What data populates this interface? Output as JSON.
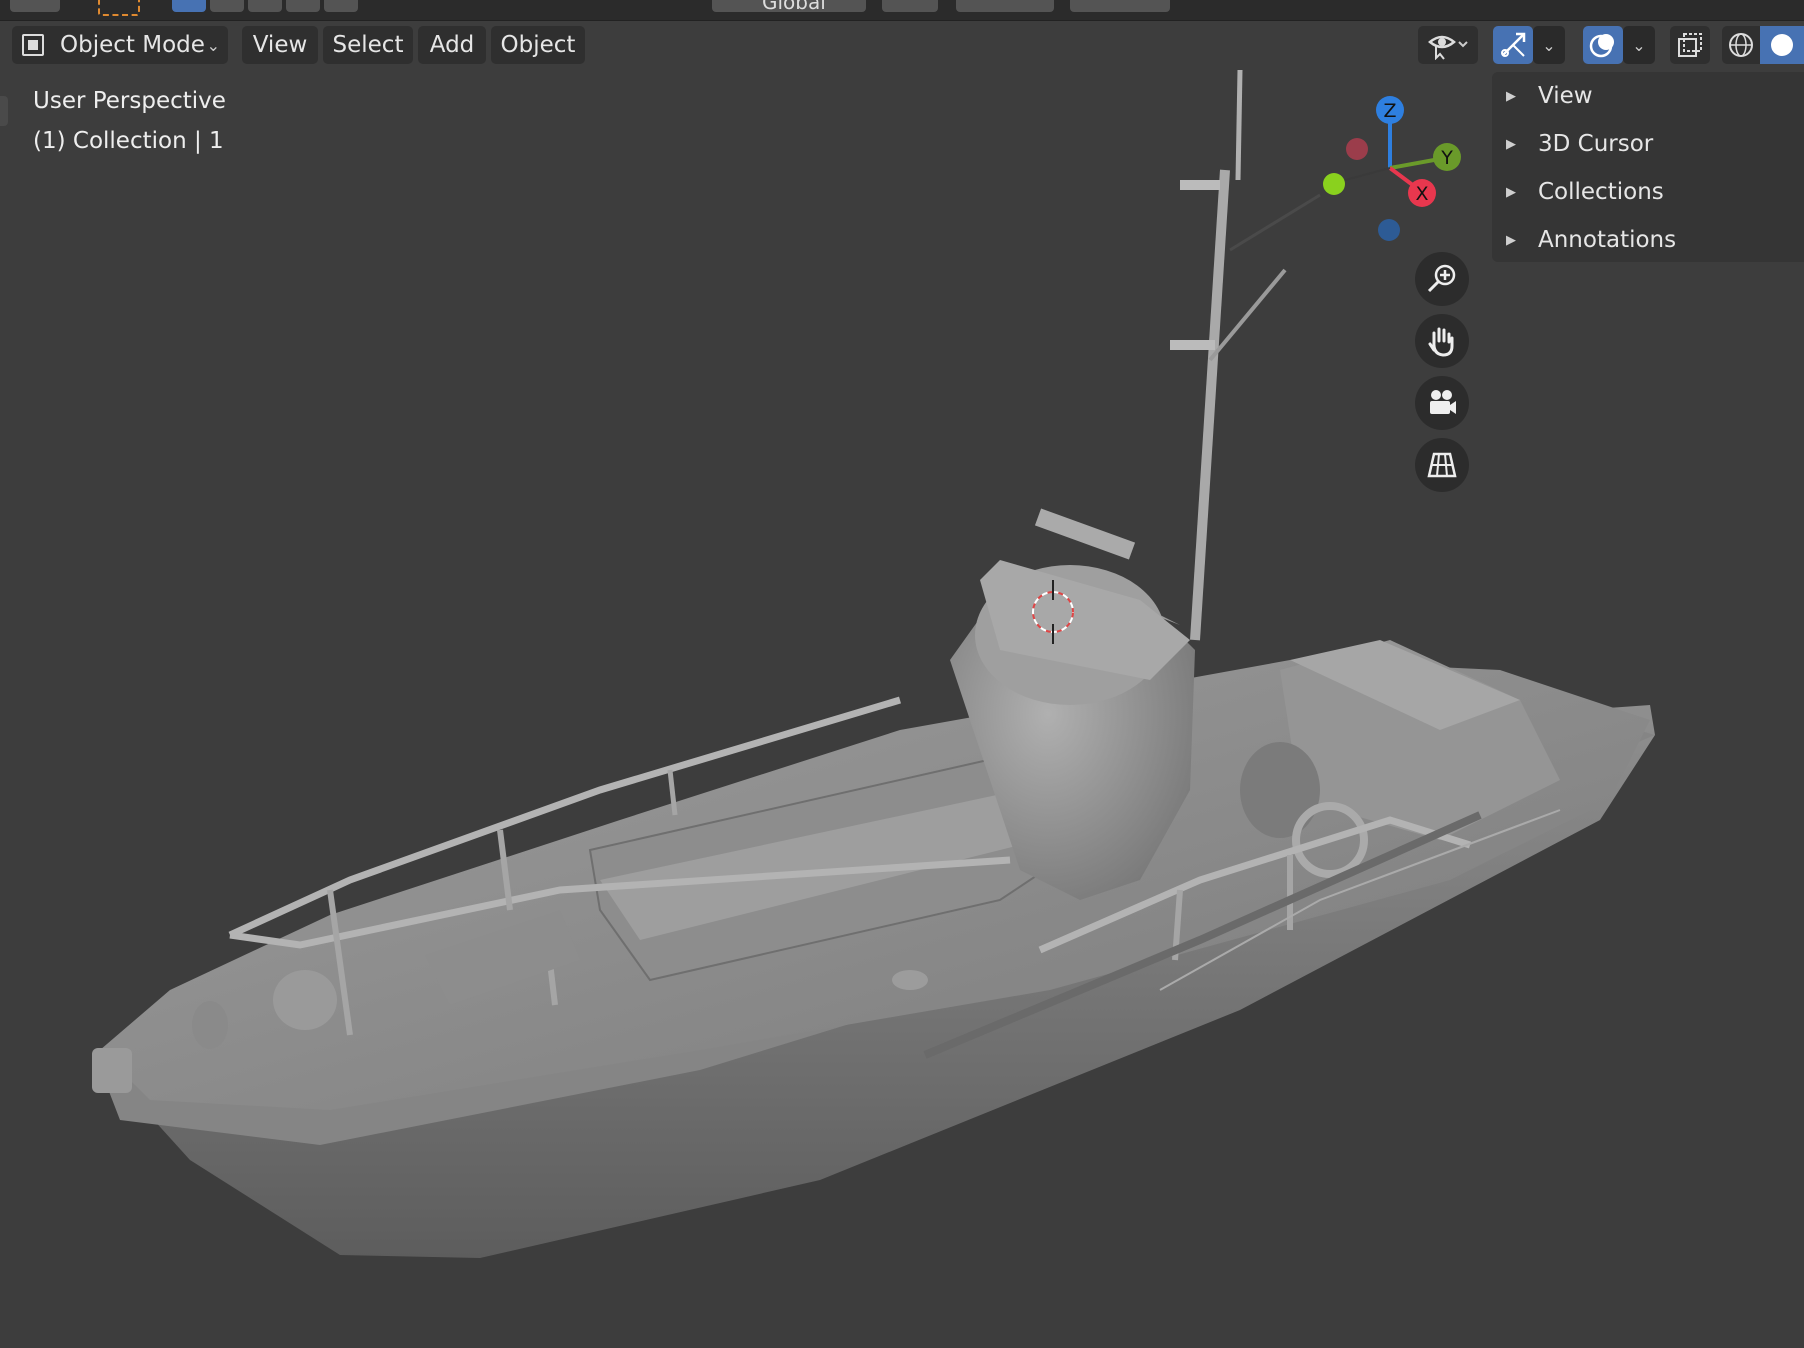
{
  "header": {
    "mode_label": "Object Mode",
    "menus": [
      "View",
      "Select",
      "Add",
      "Object"
    ]
  },
  "topbar": {
    "orientation_label": "Global"
  },
  "viewport": {
    "perspective_label": "User Perspective",
    "collection_label": "(1) Collection | 1"
  },
  "sidebar": {
    "items": [
      {
        "label": "View"
      },
      {
        "label": "3D Cursor"
      },
      {
        "label": "Collections"
      },
      {
        "label": "Annotations"
      }
    ]
  },
  "gizmo": {
    "axes": [
      {
        "label": "Z",
        "color": "#2e7fe0"
      },
      {
        "label": "Y",
        "color": "#6a9a2a"
      },
      {
        "label": "X",
        "color": "#e8374e"
      }
    ]
  },
  "nav_tools": [
    {
      "icon": "zoom-icon"
    },
    {
      "icon": "hand-pan-icon"
    },
    {
      "icon": "camera-icon"
    },
    {
      "icon": "grid-perspective-icon"
    }
  ],
  "colors": {
    "viewport_bg": "#3d3d3d",
    "accent_blue": "#4772b3",
    "model_gray": "#8a8a8a"
  }
}
